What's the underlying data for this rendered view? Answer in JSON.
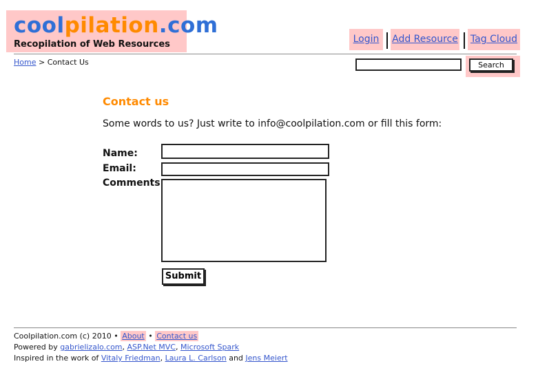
{
  "header": {
    "logo": {
      "part1": "cool",
      "part2": "pilation",
      "part3": ".com"
    },
    "tagline": "Recopilation of Web Resources",
    "nav": {
      "login": "Login",
      "add_resource": "Add Resource",
      "tag_cloud": "Tag Cloud"
    }
  },
  "breadcrumb": {
    "home": "Home",
    "sep": " > ",
    "current": "Contact Us"
  },
  "search": {
    "value": "",
    "button": "Search"
  },
  "main": {
    "heading": "Contact us",
    "intro": "Some words to us? Just write to info@coolpilation.com or fill this form:",
    "form": {
      "name_label": "Name:",
      "email_label": "Email:",
      "comments_label": "Comments:",
      "submit": "Submit"
    }
  },
  "footer": {
    "copyright": "Coolpilation.com (c) 2010",
    "bullet": "•",
    "about": "About",
    "contact": "Contact us",
    "powered_by": "Powered by",
    "powered_links": [
      "gabrielizalo.com",
      "ASP.Net MVC",
      "Microsoft Spark"
    ],
    "inspired": "Inspired in the work of",
    "inspired_links": [
      "Vitaly Friedman",
      "Laura L. Carlson",
      "Jens Meiert"
    ],
    "and": "and",
    "comma": ","
  },
  "colors": {
    "accent_pink": "#ffc8c8",
    "logo_blue": "#2f6fd6",
    "logo_orange": "#ff8a00",
    "link_blue": "#3355cc"
  }
}
